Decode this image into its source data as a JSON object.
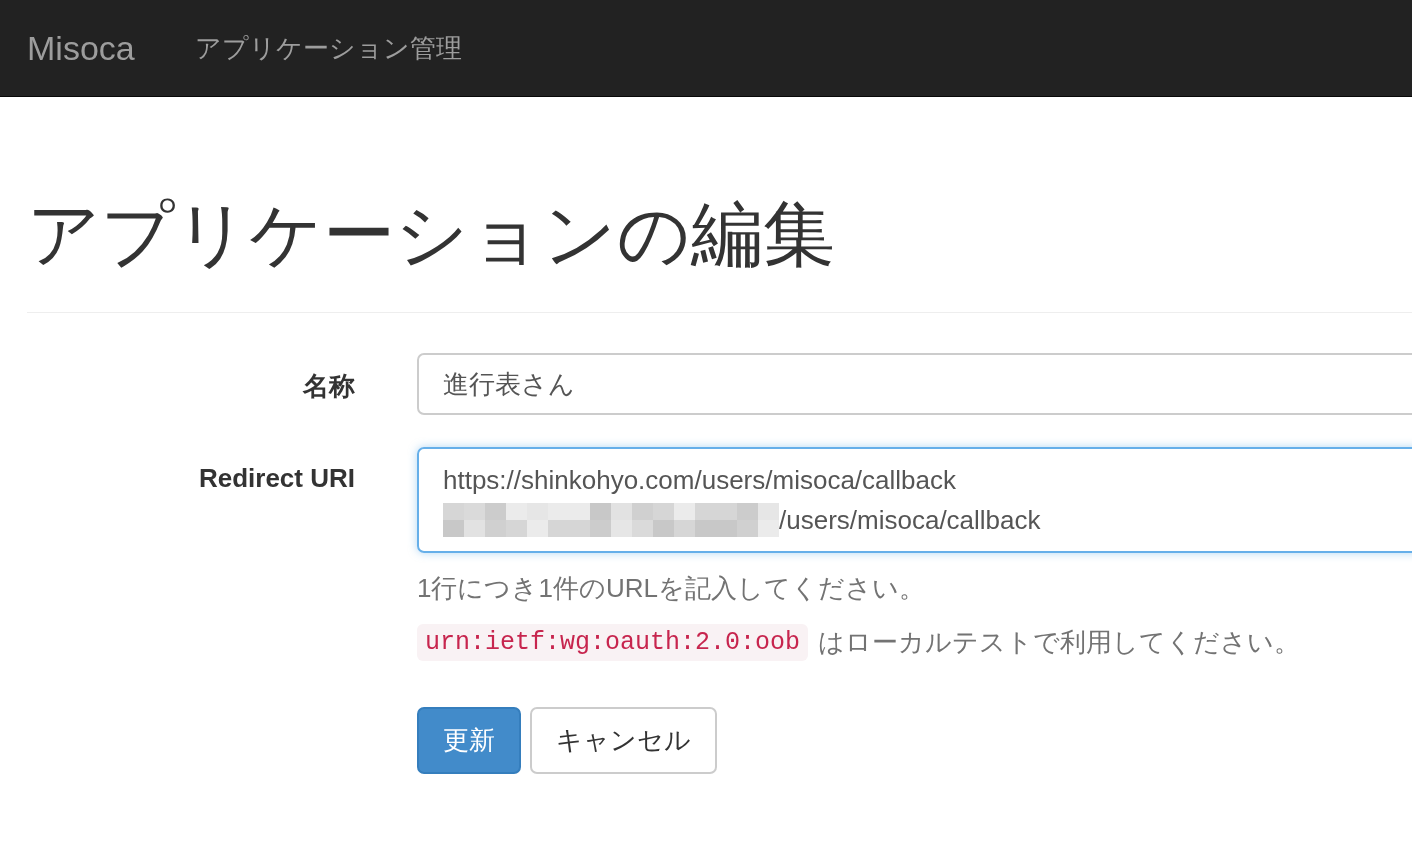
{
  "navbar": {
    "brand": "Misoca",
    "links": [
      "アプリケーション管理"
    ]
  },
  "heading": "アプリケーションの編集",
  "fields": [
    {
      "label": "名称",
      "kind": "input",
      "focused": false,
      "value": "進行表さん"
    },
    {
      "label": "Redirect URI",
      "kind": "textarea",
      "focused": true,
      "lines": [
        {
          "redacted": false,
          "text": "https://shinkohyo.com/users/misoca/callback"
        },
        {
          "redacted": true,
          "text": "/users/misoca/callback"
        }
      ],
      "help": [
        {
          "text": "1行につき1件のURLを記入してください。"
        },
        {
          "code": "urn:ietf:wg:oauth:2.0:oob",
          "text": "はローカルテストで利用してください。"
        }
      ]
    }
  ],
  "buttons": [
    {
      "label": "更新",
      "kind": "primary"
    },
    {
      "label": "キャンセル",
      "kind": "default"
    }
  ]
}
